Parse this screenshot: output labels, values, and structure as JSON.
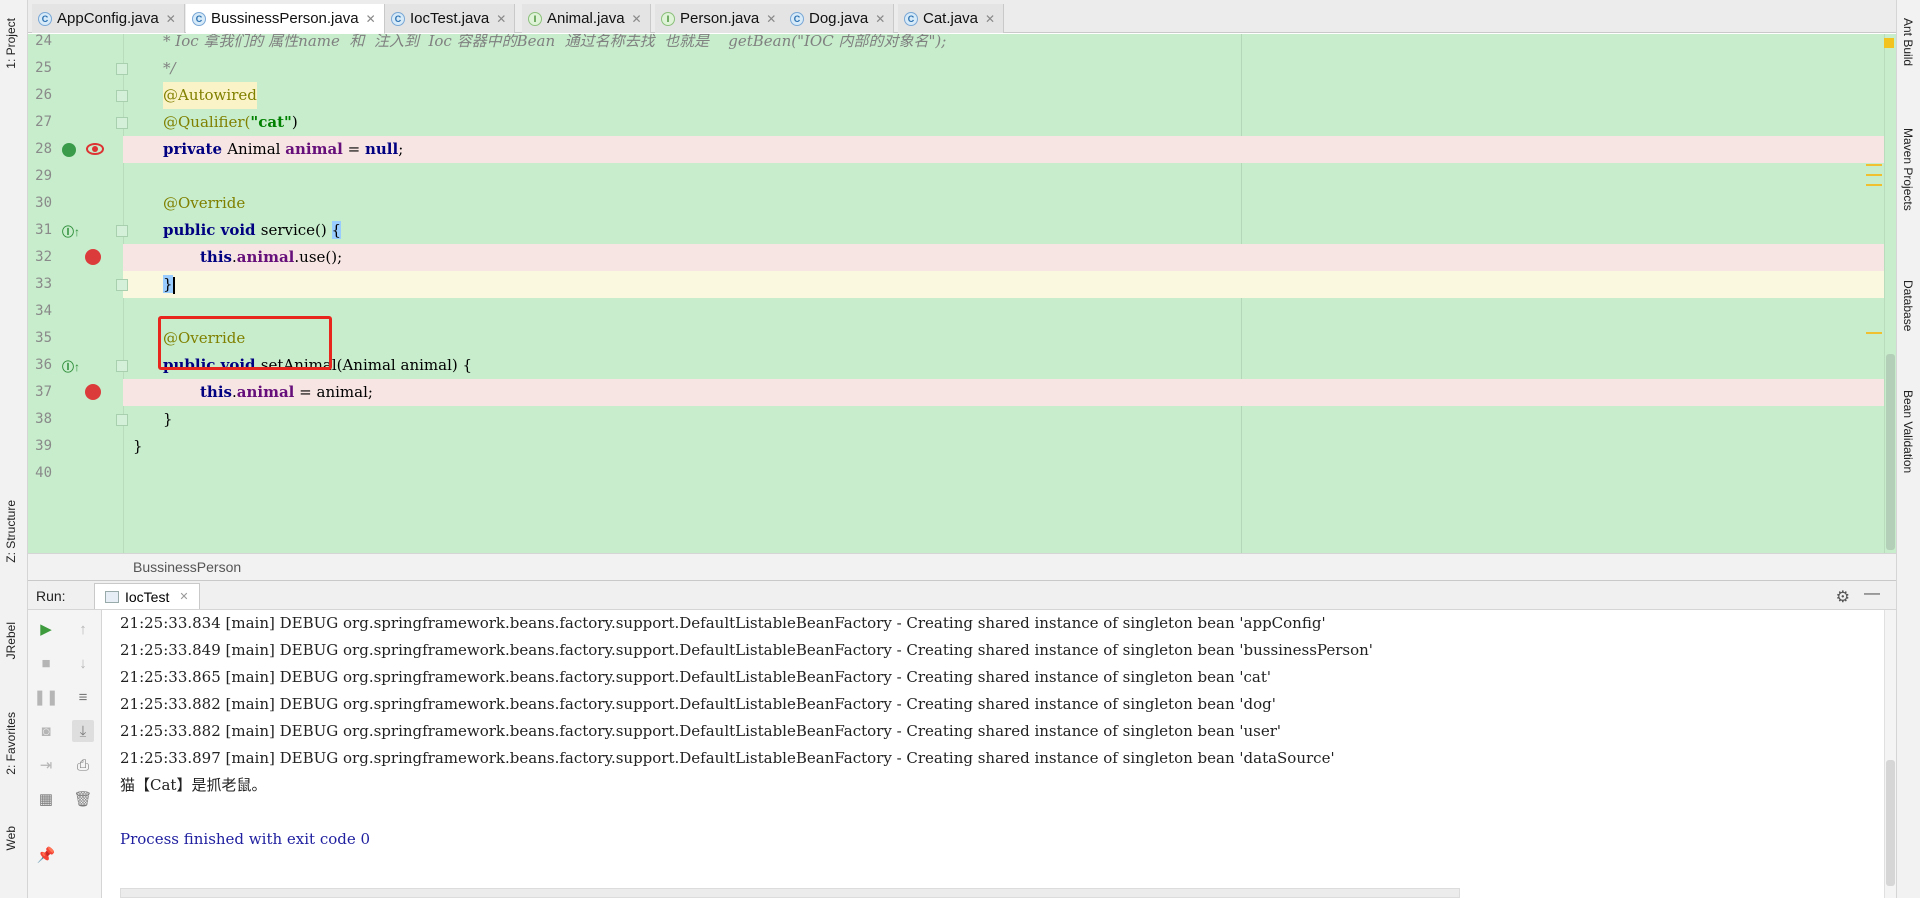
{
  "tabs": [
    {
      "name": "AppConfig.java",
      "kind": "C",
      "active": false
    },
    {
      "name": "BussinessPerson.java",
      "kind": "C",
      "active": true
    },
    {
      "name": "IocTest.java",
      "kind": "C",
      "active": false
    },
    {
      "name": "Animal.java",
      "kind": "I",
      "active": false
    },
    {
      "name": "Person.java",
      "kind": "I",
      "active": false
    },
    {
      "name": "Dog.java",
      "kind": "C",
      "active": false
    },
    {
      "name": "Cat.java",
      "kind": "C",
      "active": false
    }
  ],
  "left_tools": {
    "project": "1: Project",
    "structure": "Z: Structure",
    "jrebel": "JRebel",
    "favorites": "2: Favorites",
    "web": "Web"
  },
  "right_tools": {
    "ant": "Ant Build",
    "maven": "Maven Projects",
    "database": "Database",
    "bean_validation": "Bean Validation"
  },
  "editor": {
    "lines": [
      {
        "n": "24",
        "text": "* Ioc 拿我们的 属性name  和  注入到  Ioc 容器中的Bean  通过名称去找  也就是    getBean(\"IOC 内部的对象名\");"
      },
      {
        "n": "25",
        "text": "*/"
      },
      {
        "n": "26",
        "text": "@Autowired"
      },
      {
        "n": "27",
        "text_a": "@Qualifier(",
        "text_b": "\"cat\"",
        "text_c": ")"
      },
      {
        "n": "28",
        "kw": "private ",
        "type": "Animal ",
        "field": "animal",
        "eq": " = ",
        "nul": "null",
        "semi": ";"
      },
      {
        "n": "29"
      },
      {
        "n": "30",
        "text": "@Override"
      },
      {
        "n": "31",
        "kw": "public void ",
        "rest": "service() ",
        "brace": "{"
      },
      {
        "n": "32",
        "kw": "this",
        "dot": ".",
        "field": "animal",
        "rest": ".use();"
      },
      {
        "n": "33",
        "brace": "}"
      },
      {
        "n": "34"
      },
      {
        "n": "35",
        "text": "@Override"
      },
      {
        "n": "36",
        "kw": "public void ",
        "rest": "setAnimal(Animal animal) {"
      },
      {
        "n": "37",
        "kw": "this",
        "dot": ".",
        "field": "animal",
        "rest": " = animal;"
      },
      {
        "n": "38",
        "text": "}"
      },
      {
        "n": "39",
        "text": "}"
      },
      {
        "n": "40"
      }
    ],
    "breadcrumb": "BussinessPerson"
  },
  "run": {
    "label": "Run:",
    "config": "IocTest",
    "output": [
      "21:25:33.834 [main] DEBUG org.springframework.beans.factory.support.DefaultListableBeanFactory - Creating shared instance of singleton bean 'appConfig'",
      "21:25:33.849 [main] DEBUG org.springframework.beans.factory.support.DefaultListableBeanFactory - Creating shared instance of singleton bean 'bussinessPerson'",
      "21:25:33.865 [main] DEBUG org.springframework.beans.factory.support.DefaultListableBeanFactory - Creating shared instance of singleton bean 'cat'",
      "21:25:33.882 [main] DEBUG org.springframework.beans.factory.support.DefaultListableBeanFactory - Creating shared instance of singleton bean 'dog'",
      "21:25:33.882 [main] DEBUG org.springframework.beans.factory.support.DefaultListableBeanFactory - Creating shared instance of singleton bean 'user'",
      "21:25:33.897 [main] DEBUG org.springframework.beans.factory.support.DefaultListableBeanFactory - Creating shared instance of singleton bean 'dataSource'",
      "猫【Cat】是抓老鼠。",
      "",
      "Process finished with exit code 0"
    ]
  },
  "colors": {
    "editor_bg": "#c7edcc",
    "breakpoint_line": "#f7e5e3",
    "current_line": "#fbf8e0",
    "highlight_box": "#e8261e"
  },
  "icons": [
    "run-icon",
    "stop-icon",
    "pause-icon",
    "camera-icon",
    "exit-icon",
    "layout-icon",
    "pin-icon",
    "scroll-up-icon",
    "scroll-down-icon",
    "soft-wrap-icon",
    "scroll-to-end-icon",
    "print-icon",
    "trash-icon",
    "gear-icon",
    "minimize-icon"
  ]
}
